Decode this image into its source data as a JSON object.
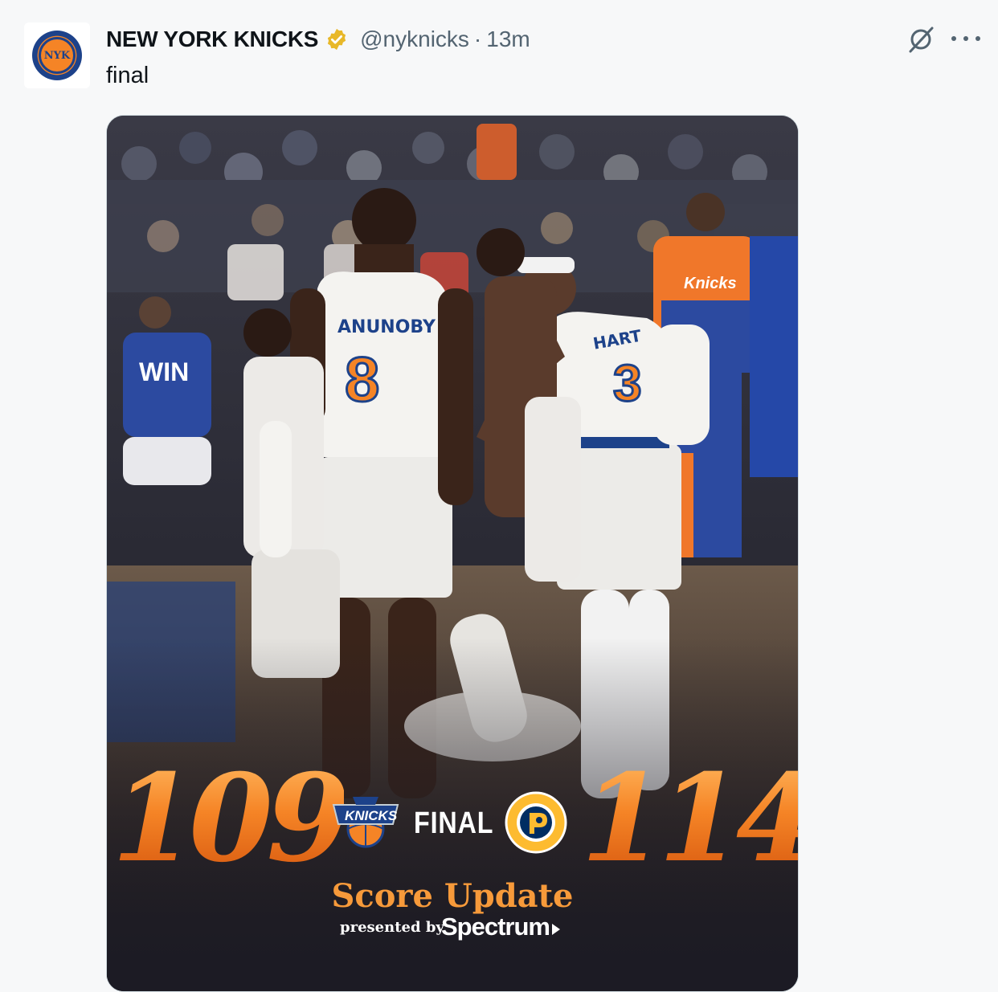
{
  "tweet": {
    "display_name": "NEW YORK KNICKS",
    "handle": "@nyknicks",
    "separator": "·",
    "time": "13m",
    "text": "final",
    "avatar_icon": "knicks-logo-icon",
    "verified_color": "#e8b829"
  },
  "actions": {
    "grok_icon": "grok-icon",
    "more_icon": "more-icon"
  },
  "graphic": {
    "home_score": "109",
    "away_score": "114",
    "status": "FINAL",
    "title": "Score Update",
    "presented_by": "presented by",
    "sponsor": "Spectrum",
    "home_team_icon": "knicks-logo",
    "away_team_icon": "pacers-logo",
    "jerseys": [
      {
        "name": "ANUNOBY",
        "number": "8"
      },
      {
        "name": "HART",
        "number": "3"
      }
    ],
    "crowd_shirt_text": "WIN",
    "bench_jacket_text": "Knicks",
    "accent_orange": "#f58426",
    "accent_blue": "#1d428a"
  }
}
